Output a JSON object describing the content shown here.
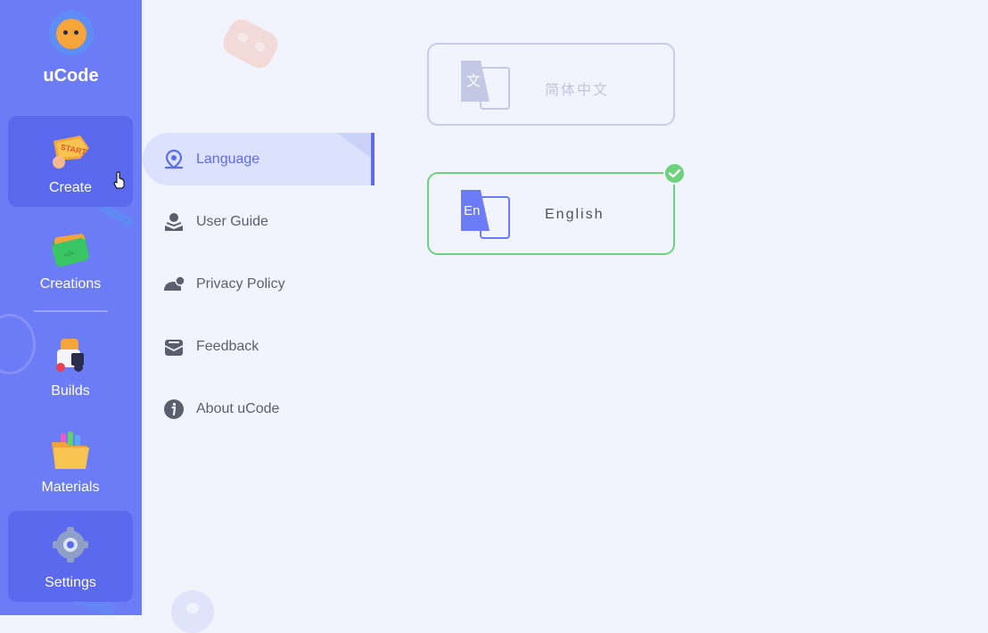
{
  "app": {
    "title": "uCode"
  },
  "sidebar": {
    "items": [
      {
        "label": "Create",
        "icon": "start-icon",
        "active": true
      },
      {
        "label": "Creations",
        "icon": "folder-icon",
        "active": false
      },
      {
        "label": "Builds",
        "icon": "robot-icon",
        "active": false
      },
      {
        "label": "Materials",
        "icon": "materials-folder-icon",
        "active": false
      },
      {
        "label": "Settings",
        "icon": "gear-icon",
        "active": true
      }
    ]
  },
  "settings_menu": {
    "items": [
      {
        "label": "Language",
        "icon": "location-pin-icon",
        "active": true
      },
      {
        "label": "User Guide",
        "icon": "user-guide-icon",
        "active": false
      },
      {
        "label": "Privacy Policy",
        "icon": "privacy-icon",
        "active": false
      },
      {
        "label": "Feedback",
        "icon": "mail-icon",
        "active": false
      },
      {
        "label": "About uCode",
        "icon": "info-icon",
        "active": false
      }
    ]
  },
  "language": {
    "options": [
      {
        "label": "简体中文",
        "icon_text": "文",
        "selected": false
      },
      {
        "label": "English",
        "icon_text": "En",
        "selected": true
      }
    ]
  },
  "colors": {
    "sidebar_bg": "#6c7cf6",
    "accent": "#5b6cef",
    "selected_border": "#6dd27c",
    "page_bg": "#f2f4fd"
  }
}
